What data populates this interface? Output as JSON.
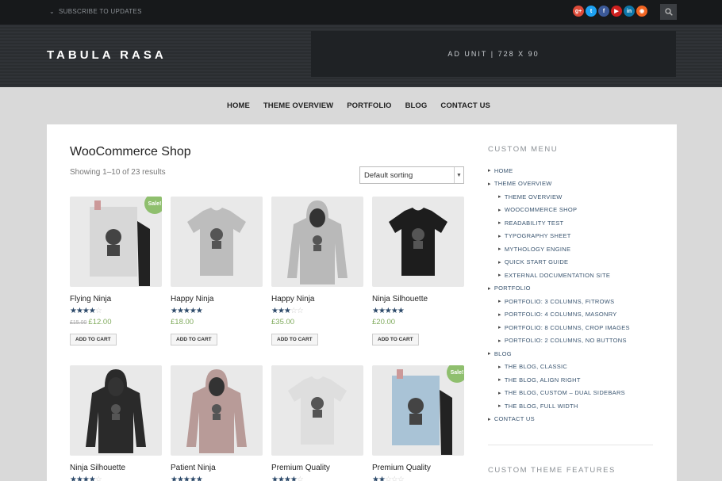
{
  "topbar": {
    "subscribe_label": "SUBSCRIBE TO UPDATES",
    "socials": [
      {
        "icon": "google-plus-icon",
        "glyph": "g+",
        "color": "#dd4b39"
      },
      {
        "icon": "twitter-icon",
        "glyph": "t",
        "color": "#1da1f2"
      },
      {
        "icon": "facebook-icon",
        "glyph": "f",
        "color": "#3b5998"
      },
      {
        "icon": "youtube-icon",
        "glyph": "▶",
        "color": "#cd201f"
      },
      {
        "icon": "linkedin-icon",
        "glyph": "in",
        "color": "#0e76a8"
      },
      {
        "icon": "rss-icon",
        "glyph": "◉",
        "color": "#f26522"
      }
    ]
  },
  "header": {
    "logo": "TABULA RASA",
    "ad_text": "AD UNIT | 728 X 90"
  },
  "nav": [
    "HOME",
    "THEME OVERVIEW",
    "PORTFOLIO",
    "BLOG",
    "CONTACT US"
  ],
  "shop": {
    "title": "WooCommerce Shop",
    "result_count": "Showing 1–10 of 23 results",
    "sort_value": "Default sorting",
    "sale_label": "Sale!",
    "cart_label": "ADD TO CART"
  },
  "products": [
    {
      "name": "Flying Ninja",
      "rating": 4,
      "old_price": "£15.00",
      "price": "£12.00",
      "sale": true,
      "kind": "poster"
    },
    {
      "name": "Happy Ninja",
      "rating": 5,
      "old_price": "",
      "price": "£18.00",
      "sale": false,
      "kind": "tee-grey"
    },
    {
      "name": "Happy Ninja",
      "rating": 3,
      "old_price": "",
      "price": "£35.00",
      "sale": false,
      "kind": "hoodie-grey"
    },
    {
      "name": "Ninja Silhouette",
      "rating": 5,
      "old_price": "",
      "price": "£20.00",
      "sale": false,
      "kind": "tee-black"
    },
    {
      "name": "Ninja Silhouette",
      "rating": 4,
      "old_price": "",
      "price": "",
      "sale": false,
      "kind": "hoodie-black"
    },
    {
      "name": "Patient Ninja",
      "rating": 5,
      "old_price": "",
      "price": "",
      "sale": false,
      "kind": "hoodie-pink"
    },
    {
      "name": "Premium Quality",
      "rating": 4,
      "old_price": "",
      "price": "",
      "sale": false,
      "kind": "tee-white"
    },
    {
      "name": "Premium Quality",
      "rating": 2,
      "old_price": "",
      "price": "",
      "sale": true,
      "kind": "poster-blue"
    }
  ],
  "sidebar": {
    "title": "CUSTOM MENU",
    "items": [
      {
        "label": "HOME",
        "sub": false
      },
      {
        "label": "THEME OVERVIEW",
        "sub": false
      },
      {
        "label": "THEME OVERVIEW",
        "sub": true
      },
      {
        "label": "WOOCOMMERCE SHOP",
        "sub": true
      },
      {
        "label": "READABILITY TEST",
        "sub": true
      },
      {
        "label": "TYPOGRAPHY SHEET",
        "sub": true
      },
      {
        "label": "MYTHOLOGY ENGINE",
        "sub": true
      },
      {
        "label": "QUICK START GUIDE",
        "sub": true
      },
      {
        "label": "EXTERNAL DOCUMENTATION SITE",
        "sub": true
      },
      {
        "label": "PORTFOLIO",
        "sub": false
      },
      {
        "label": "PORTFOLIO: 3 COLUMNS, FITROWS",
        "sub": true
      },
      {
        "label": "PORTFOLIO: 4 COLUMNS, MASONRY",
        "sub": true
      },
      {
        "label": "PORTFOLIO: 8 COLUMNS, CROP IMAGES",
        "sub": true
      },
      {
        "label": "PORTFOLIO: 2 COLUMNS, NO BUTTONS",
        "sub": true
      },
      {
        "label": "BLOG",
        "sub": false
      },
      {
        "label": "THE BLOG, CLASSIC",
        "sub": true
      },
      {
        "label": "THE BLOG, ALIGN RIGHT",
        "sub": true
      },
      {
        "label": "THE BLOG, CUSTOM – DUAL SIDEBARS",
        "sub": true
      },
      {
        "label": "THE BLOG, FULL WIDTH",
        "sub": true
      },
      {
        "label": "CONTACT US",
        "sub": false
      }
    ],
    "second_title": "CUSTOM THEME FEATURES"
  }
}
